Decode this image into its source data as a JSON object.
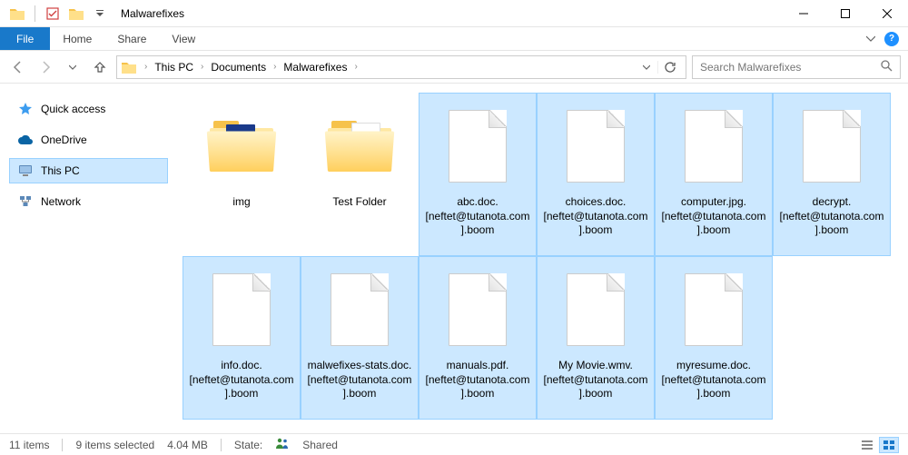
{
  "window": {
    "title": "Malwarefixes"
  },
  "ribbon": {
    "file": "File",
    "tabs": [
      "Home",
      "Share",
      "View"
    ]
  },
  "breadcrumbs": [
    "This PC",
    "Documents",
    "Malwarefixes"
  ],
  "search": {
    "placeholder": "Search Malwarefixes"
  },
  "sidebar": {
    "items": [
      {
        "label": "Quick access",
        "icon": "star"
      },
      {
        "label": "OneDrive",
        "icon": "cloud"
      },
      {
        "label": "This PC",
        "icon": "pc",
        "active": true
      },
      {
        "label": "Network",
        "icon": "network"
      }
    ]
  },
  "files": [
    {
      "name": "img",
      "type": "folder",
      "selected": false
    },
    {
      "name": "Test Folder",
      "type": "folder",
      "selected": false
    },
    {
      "name": "abc.doc.[neftet@tutanota.com].boom",
      "type": "file",
      "selected": true
    },
    {
      "name": "choices.doc.[neftet@tutanota.com].boom",
      "type": "file",
      "selected": true
    },
    {
      "name": "computer.jpg.[neftet@tutanota.com].boom",
      "type": "file",
      "selected": true
    },
    {
      "name": "decrypt.[neftet@tutanota.com].boom",
      "type": "file",
      "selected": true
    },
    {
      "name": "info.doc.[neftet@tutanota.com].boom",
      "type": "file",
      "selected": true
    },
    {
      "name": "malwefixes-stats.doc.[neftet@tutanota.com].boom",
      "type": "file",
      "selected": true
    },
    {
      "name": "manuals.pdf.[neftet@tutanota.com].boom",
      "type": "file",
      "selected": true
    },
    {
      "name": "My Movie.wmv.[neftet@tutanota.com].boom",
      "type": "file",
      "selected": true
    },
    {
      "name": "myresume.doc.[neftet@tutanota.com].boom",
      "type": "file",
      "selected": true
    }
  ],
  "status": {
    "count": "11 items",
    "selected": "9 items selected",
    "size": "4.04 MB",
    "stateLabel": "State:",
    "stateValue": "Shared"
  }
}
